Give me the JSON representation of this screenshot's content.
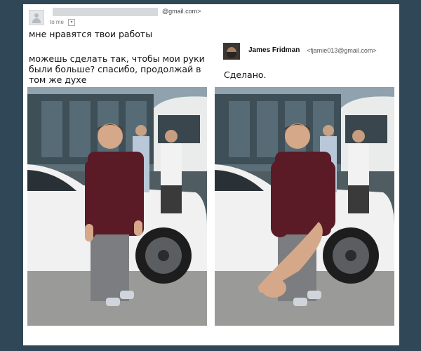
{
  "sender": {
    "email_suffix": "@gmail.com>",
    "recipient_label": "to me",
    "dropdown_glyph": "▾"
  },
  "message": {
    "line1": "мне нравятся твои работы",
    "line2": "можешь сделать так, чтобы мои руки были больше? спасибо, продолжай в том же духе"
  },
  "reply": {
    "name": "James Fridman",
    "email": "<fjamie013@gmail.com>",
    "text": "Сделано."
  },
  "photos": [
    {
      "name": "original-photo",
      "arms": "normal"
    },
    {
      "name": "edited-photo",
      "arms": "enlarged"
    }
  ],
  "colors": {
    "background": "#2f4756",
    "card": "#ffffff"
  }
}
